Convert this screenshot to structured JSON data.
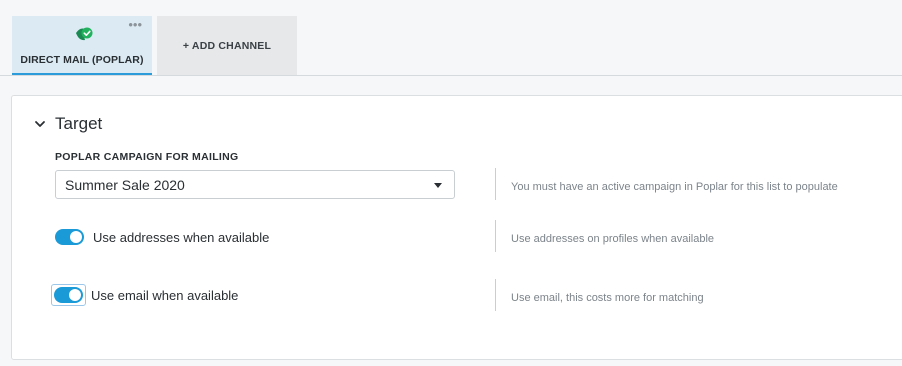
{
  "tabs": {
    "active": {
      "label": "DIRECT MAIL (POPLAR)",
      "icon": "poplar-check-icon",
      "more": "•••"
    },
    "add_label": "+ ADD CHANNEL"
  },
  "target": {
    "title": "Target",
    "campaign": {
      "label": "POPLAR CAMPAIGN FOR MAILING",
      "selected": "Summer Sale 2020",
      "help": "You must have an active campaign in Poplar for this list to populate"
    },
    "addresses": {
      "label": "Use addresses when available",
      "enabled": true,
      "help": "Use addresses on profiles when available"
    },
    "email": {
      "label": "Use email when available",
      "enabled": true,
      "help": "Use email, this costs more for matching"
    }
  },
  "colors": {
    "accent": "#1b9ad8",
    "active_tab_bg": "#dcebf3",
    "brand_green": "#1fa65a"
  }
}
